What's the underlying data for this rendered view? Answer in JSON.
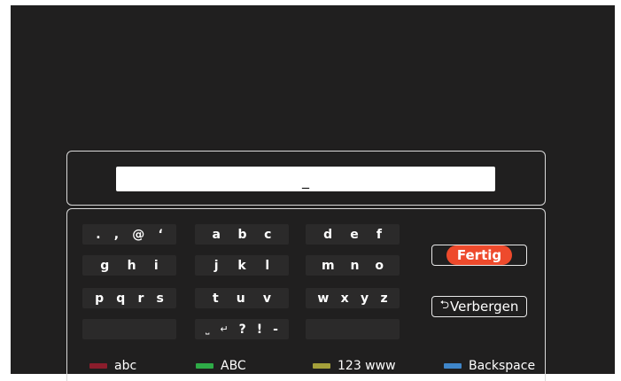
{
  "input": {
    "value": "_"
  },
  "keyboard": {
    "rows": [
      [
        [
          ".",
          ",",
          "@",
          "‘"
        ],
        [
          "a",
          "b",
          "c"
        ],
        [
          "d",
          "e",
          "f"
        ]
      ],
      [
        [
          "g",
          "h",
          "i"
        ],
        [
          "j",
          "k",
          "l"
        ],
        [
          "m",
          "n",
          "o"
        ]
      ],
      [
        [
          "p",
          "q",
          "r",
          "s"
        ],
        [
          "t",
          "u",
          "v"
        ],
        [
          "w",
          "x",
          "y",
          "z"
        ]
      ],
      [
        [],
        [
          "⎵",
          "↵",
          "?",
          "!",
          "-"
        ],
        []
      ]
    ]
  },
  "buttons": {
    "done_label": "Fertig",
    "hide_label": "Verbergen",
    "hide_icon": "⮌",
    "done_color": "#ee4a2c"
  },
  "legend": [
    {
      "label": "abc",
      "color": "#8b1d2c",
      "icon": "red-key"
    },
    {
      "label": "ABC",
      "color": "#2eab47",
      "icon": "green-key"
    },
    {
      "label": "123 www",
      "color": "#a5a03a",
      "icon": "yellow-key"
    },
    {
      "label": "Backspace",
      "color": "#3f86c9",
      "icon": "blue-key"
    }
  ]
}
